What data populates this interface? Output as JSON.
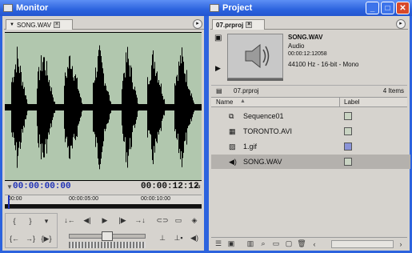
{
  "monitor": {
    "title": "Monitor",
    "tab_label": "SONG.WAV",
    "current_time": "00:00:00:00",
    "duration": "00:00:12:12",
    "ruler": [
      "00:00",
      "00:00:05:00",
      "00:00:10:00"
    ]
  },
  "project": {
    "title": "Project",
    "tab_label": "07.prproj",
    "clip_name": "SONG.WAV",
    "clip_type": "Audio",
    "clip_duration": "00:00:12:12058",
    "clip_format": "44100 Hz - 16-bit - Mono",
    "bin_name": "07.prproj",
    "item_count": "4 Items",
    "columns": {
      "name": "Name",
      "label": "Label"
    },
    "items": [
      {
        "name": "Sequence01",
        "icon": "sequence-icon",
        "color": "#c9d4c3"
      },
      {
        "name": "TORONTO.AVI",
        "icon": "video-clip-icon",
        "color": "#c9d4c3"
      },
      {
        "name": "1.gif",
        "icon": "image-icon",
        "color": "#8a93d8"
      },
      {
        "name": "SONG.WAV",
        "icon": "audio-icon",
        "color": "#c9d4c3"
      }
    ]
  },
  "colors": {
    "titlebar": "#2c63de",
    "selection": "#b4b1ad",
    "timecode_blue": "#1c2fb5",
    "wave_bg": "#b1c7ae"
  }
}
